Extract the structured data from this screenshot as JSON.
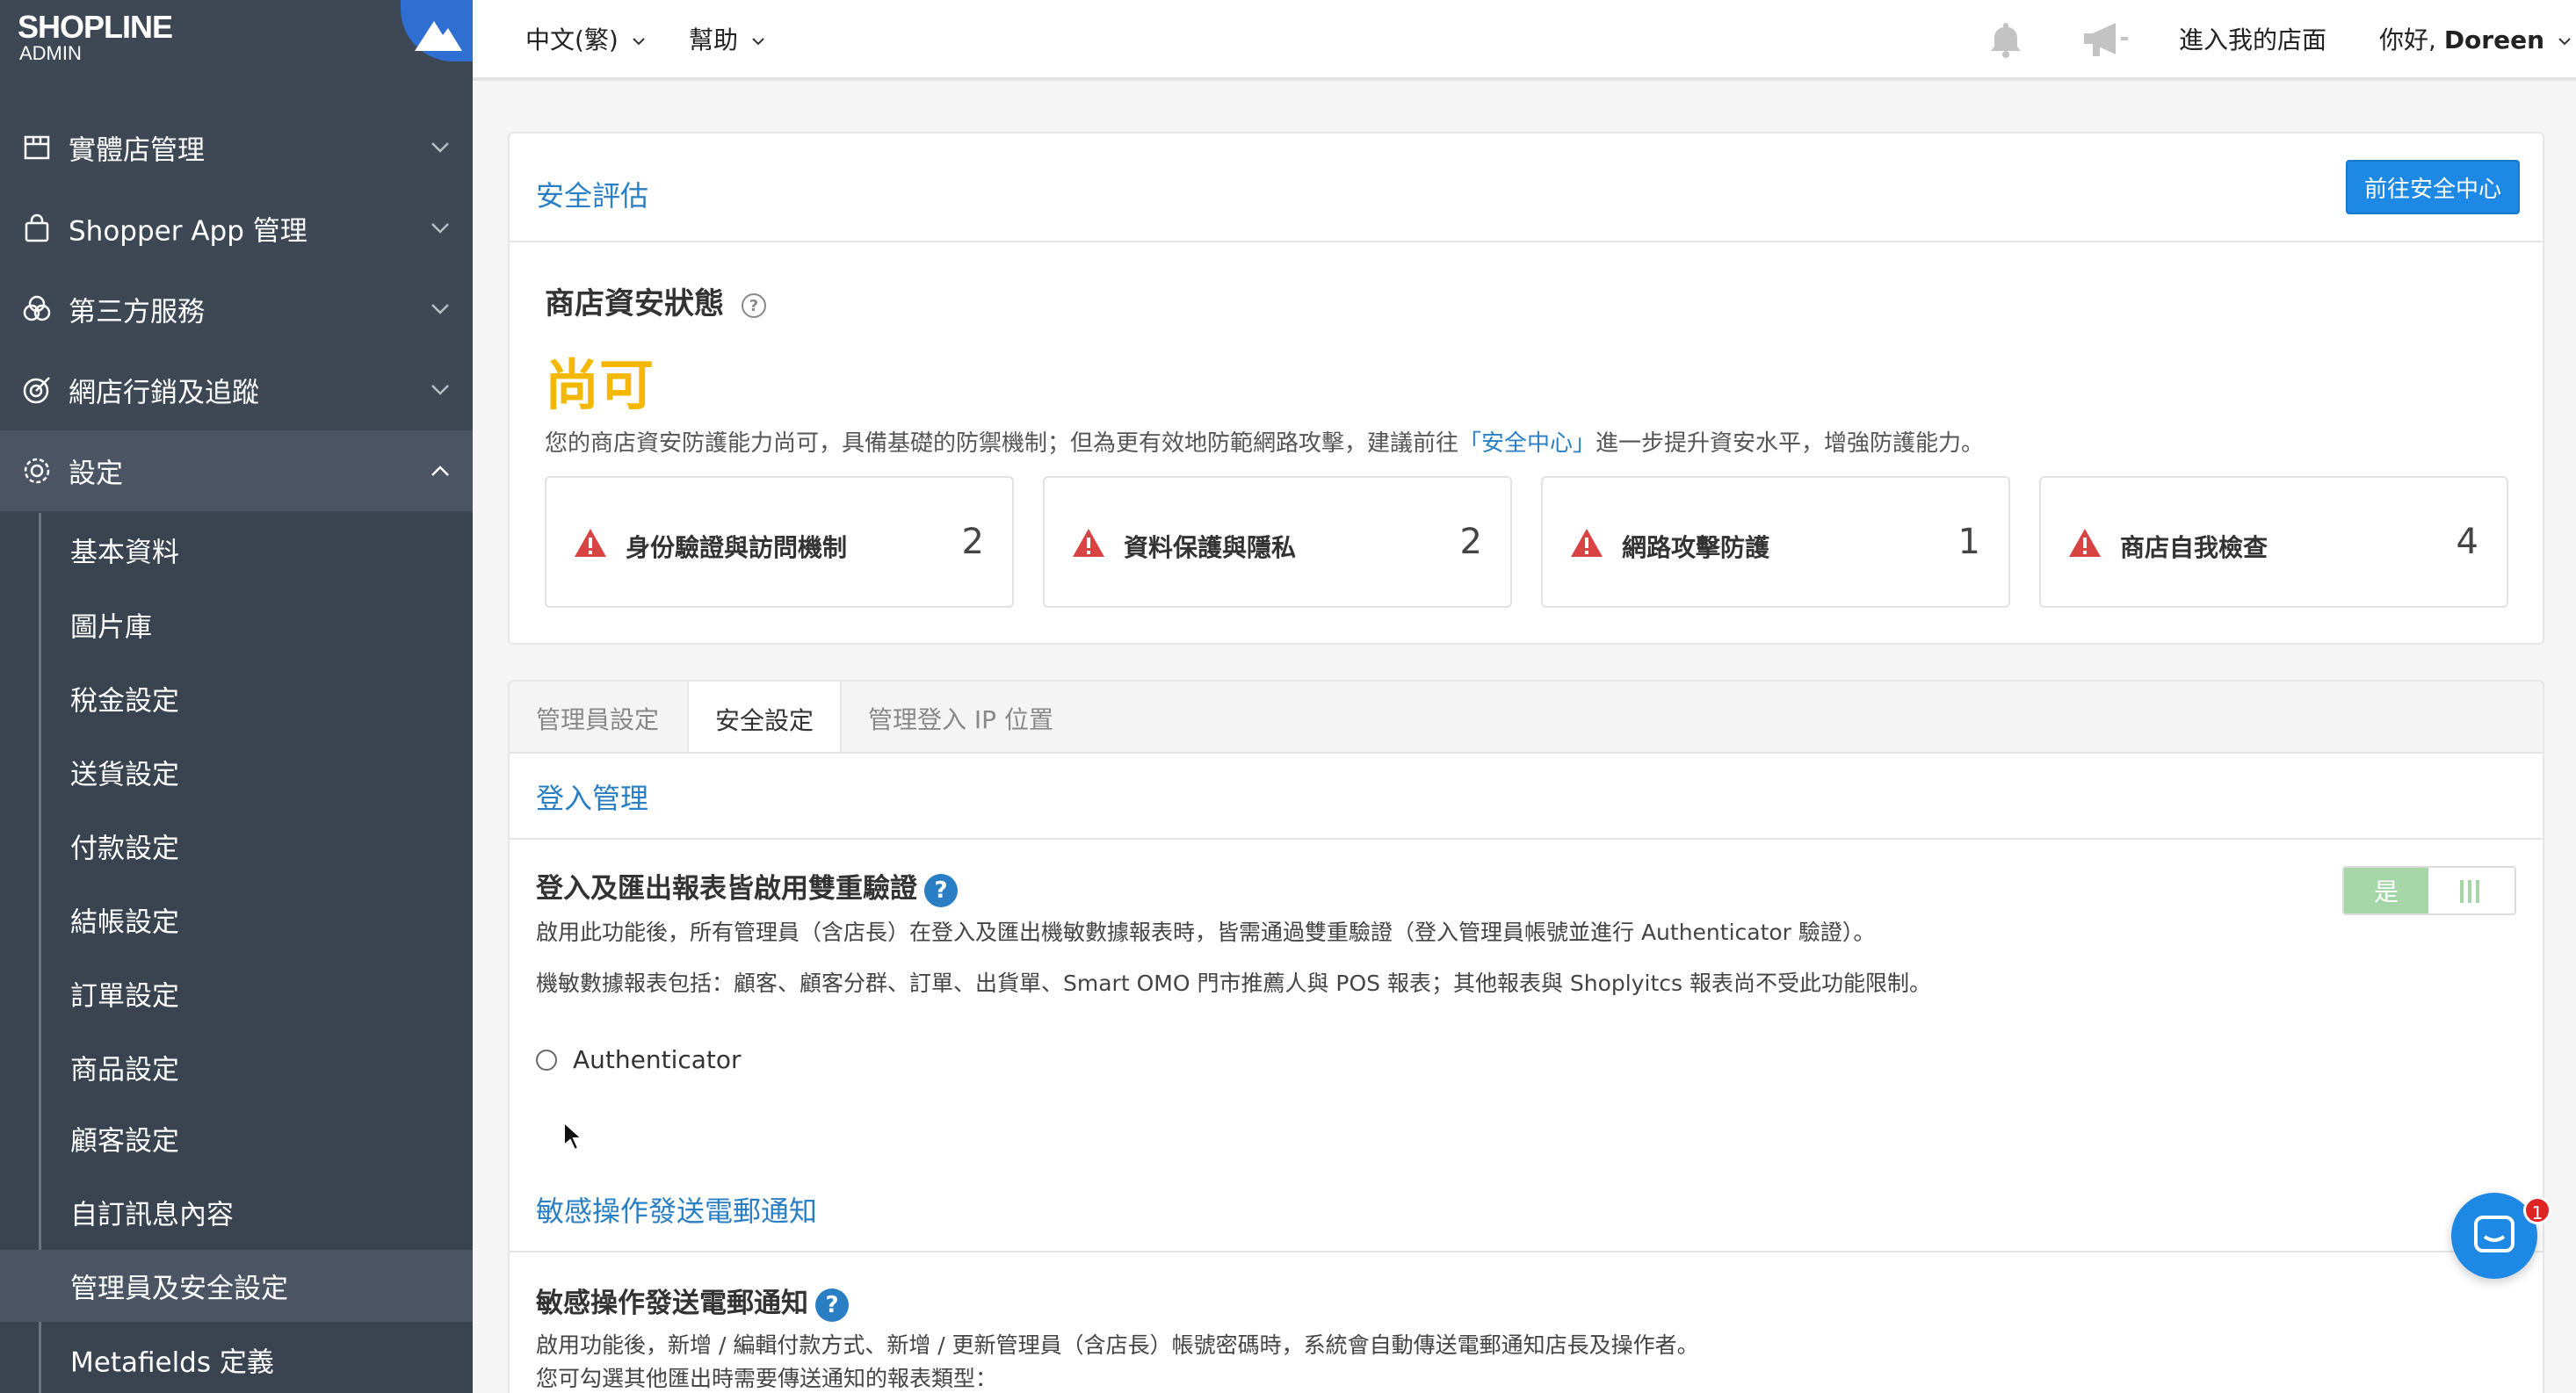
{
  "brand": {
    "name": "SHOPLINE",
    "sub": "ADMIN"
  },
  "sidebar": {
    "items": [
      {
        "label": "實體店管理",
        "icon": "store-icon"
      },
      {
        "label": "Shopper App 管理",
        "icon": "shopping-bag-icon"
      },
      {
        "label": "第三方服務",
        "icon": "services-icon"
      },
      {
        "label": "網店行銷及追蹤",
        "icon": "target-icon"
      },
      {
        "label": "設定",
        "icon": "gear-icon"
      }
    ],
    "sub_items": [
      "基本資料",
      "圖片庫",
      "稅金設定",
      "送貨設定",
      "付款設定",
      "結帳設定",
      "訂單設定",
      "商品設定",
      "顧客設定",
      "自訂訊息內容",
      "管理員及安全設定",
      "Metafields 定義"
    ]
  },
  "topbar": {
    "language": "中文(繁)",
    "help": "幫助",
    "storefront": "進入我的店面",
    "greeting": "你好, ",
    "user": "Doreen"
  },
  "assessment": {
    "title": "安全評估",
    "button": "前往安全中心",
    "status_title": "商店資安狀態",
    "status_value": "尚可",
    "status_color": "#f5b800",
    "desc_pre": "您的商店資安防護能力尚可，具備基礎的防禦機制；但為更有效地防範網路攻擊，建議前往",
    "desc_link": "「安全中心」",
    "desc_post": "進一步提升資安水平，增強防護能力。",
    "stats": [
      {
        "label": "身份驗證與訪問機制",
        "count": "2"
      },
      {
        "label": "資料保護與隱私",
        "count": "2"
      },
      {
        "label": "網路攻擊防護",
        "count": "1"
      },
      {
        "label": "商店自我檢查",
        "count": "4"
      }
    ]
  },
  "tabs": [
    "管理員設定",
    "安全設定",
    "管理登入 IP 位置"
  ],
  "login_mgmt": {
    "section_title": "登入管理",
    "heading": "登入及匯出報表皆啟用雙重驗證",
    "desc1": "啟用此功能後，所有管理員（含店長）在登入及匯出機敏數據報表時，皆需通過雙重驗證（登入管理員帳號並進行 Authenticator 驗證）。",
    "desc2": "機敏數據報表包括：顧客、顧客分群、訂單、出貨單、Smart OMO 門市推薦人與 POS 報表；其他報表與 Shoplyitcs 報表尚不受此功能限制。",
    "option": "Authenticator",
    "toggle_label": "是"
  },
  "email_notify": {
    "section_title": "敏感操作發送電郵通知",
    "heading": "敏感操作發送電郵通知",
    "desc1": "啟用功能後，新增 / 編輯付款方式、新增 / 更新管理員（含店長）帳號密碼時，系統會自動傳送電郵通知店長及操作者。",
    "desc2": "您可勾選其他匯出時需要傳送通知的報表類型："
  },
  "chat": {
    "badge": "1"
  }
}
